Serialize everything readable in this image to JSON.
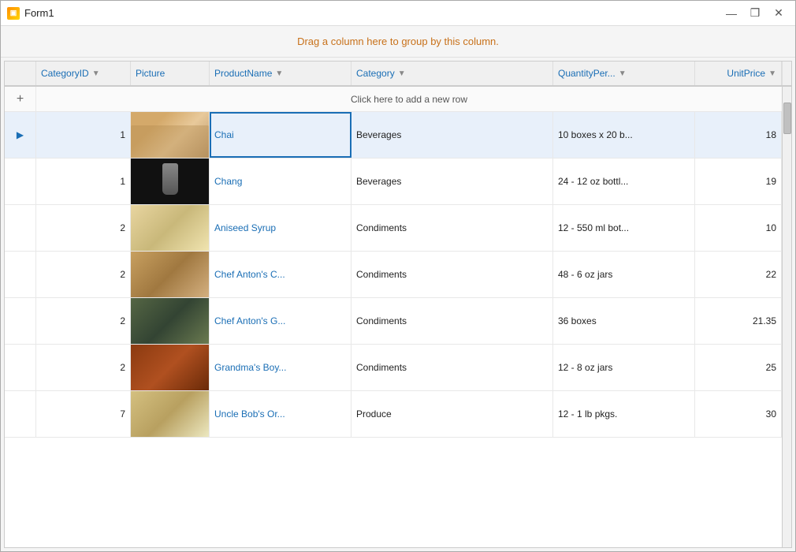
{
  "window": {
    "title": "Form1",
    "icon": "▣"
  },
  "controls": {
    "minimize": "—",
    "maximize": "❒",
    "close": "✕"
  },
  "banner": {
    "text": "Drag a column here to group by this column."
  },
  "grid": {
    "add_row_label": "Click here to add a new row",
    "columns": [
      {
        "label": "CategoryID",
        "has_filter": true
      },
      {
        "label": "Picture",
        "has_filter": false
      },
      {
        "label": "ProductName",
        "has_filter": true
      },
      {
        "label": "Category",
        "has_filter": true
      },
      {
        "label": "QuantityPer...",
        "has_filter": true
      },
      {
        "label": "UnitPrice",
        "has_filter": true
      }
    ],
    "rows": [
      {
        "indicator": "▶",
        "category_id": "1",
        "img_class": "img-chai",
        "product_name": "Chai",
        "category": "Beverages",
        "quantity_per": "10 boxes x 20 b...",
        "unit_price": "18",
        "editing": true
      },
      {
        "indicator": "",
        "category_id": "1",
        "img_class": "img-chang",
        "product_name": "Chang",
        "category": "Beverages",
        "quantity_per": "24 - 12 oz bottl...",
        "unit_price": "19",
        "editing": false
      },
      {
        "indicator": "",
        "category_id": "2",
        "img_class": "img-aniseed",
        "product_name": "Aniseed Syrup",
        "category": "Condiments",
        "quantity_per": "12 - 550 ml bot...",
        "unit_price": "10",
        "editing": false
      },
      {
        "indicator": "",
        "category_id": "2",
        "img_class": "img-chefanton1",
        "product_name": "Chef Anton's C...",
        "category": "Condiments",
        "quantity_per": "48 - 6 oz jars",
        "unit_price": "22",
        "editing": false
      },
      {
        "indicator": "",
        "category_id": "2",
        "img_class": "img-chefanton2",
        "product_name": "Chef Anton's G...",
        "category": "Condiments",
        "quantity_per": "36 boxes",
        "unit_price": "21.35",
        "editing": false
      },
      {
        "indicator": "",
        "category_id": "2",
        "img_class": "img-grandma",
        "product_name": "Grandma's  Boy...",
        "category": "Condiments",
        "quantity_per": "12 - 8 oz jars",
        "unit_price": "25",
        "editing": false
      },
      {
        "indicator": "",
        "category_id": "7",
        "img_class": "img-uncle",
        "product_name": "Uncle Bob's Or...",
        "category": "Produce",
        "quantity_per": "12 - 1 lb pkgs.",
        "unit_price": "30",
        "editing": false
      }
    ]
  }
}
